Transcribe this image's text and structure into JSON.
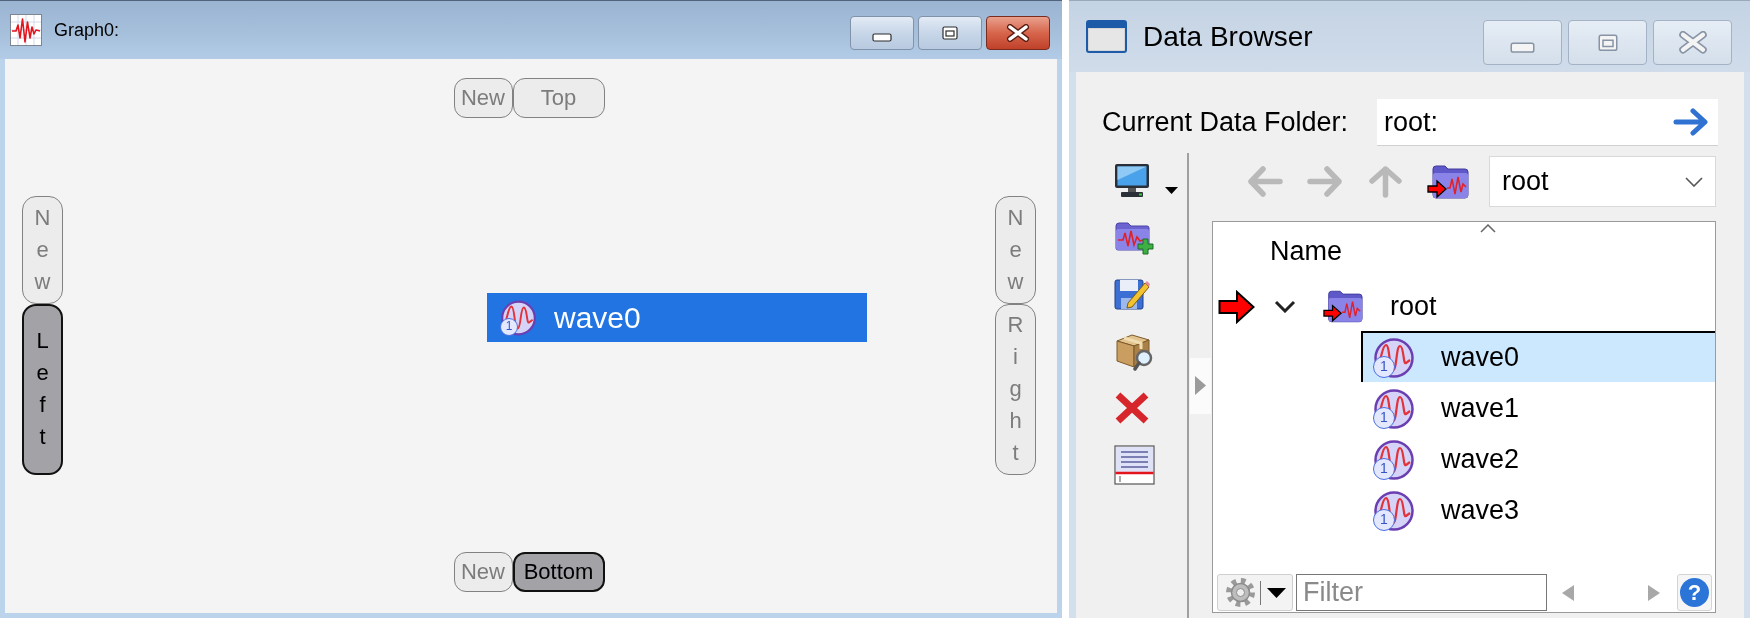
{
  "graph_window": {
    "title": "Graph0:",
    "active": true,
    "top_buttons": [
      {
        "kind": "new",
        "label": "New",
        "selected": false
      },
      {
        "kind": "axis",
        "label": "Top",
        "selected": false
      }
    ],
    "left_buttons": [
      {
        "kind": "new",
        "label": "New",
        "selected": false
      },
      {
        "kind": "axis",
        "label": "Left",
        "selected": true
      }
    ],
    "right_buttons": [
      {
        "kind": "new",
        "label": "New",
        "selected": false
      },
      {
        "kind": "axis",
        "label": "Right",
        "selected": false
      }
    ],
    "bottom_buttons": [
      {
        "kind": "new",
        "label": "New",
        "selected": false
      },
      {
        "kind": "axis",
        "label": "Bottom",
        "selected": true
      }
    ],
    "trace": {
      "name": "wave0",
      "badge": "1",
      "selected": true
    }
  },
  "data_browser": {
    "title": "Data Browser",
    "active": false,
    "current_folder": {
      "label": "Current Data Folder:",
      "value": "root:"
    },
    "nav_buttons": [
      {
        "kind": "back",
        "disabled": true
      },
      {
        "kind": "forward",
        "disabled": true
      },
      {
        "kind": "up",
        "disabled": true
      }
    ],
    "folder_dropdown": {
      "value": "root"
    },
    "tree": {
      "column": "Name",
      "items": [
        {
          "kind": "folder",
          "name": "root",
          "current": true,
          "expanded": true,
          "selected": false,
          "children": [
            {
              "kind": "wave",
              "name": "wave0",
              "badge": "1",
              "selected": true
            },
            {
              "kind": "wave",
              "name": "wave1",
              "badge": "1",
              "selected": false
            },
            {
              "kind": "wave",
              "name": "wave2",
              "badge": "1",
              "selected": false
            },
            {
              "kind": "wave",
              "name": "wave3",
              "badge": "1",
              "selected": false
            }
          ]
        }
      ]
    },
    "filter": {
      "placeholder": "Filter"
    },
    "help_button": {
      "label": "?"
    }
  }
}
